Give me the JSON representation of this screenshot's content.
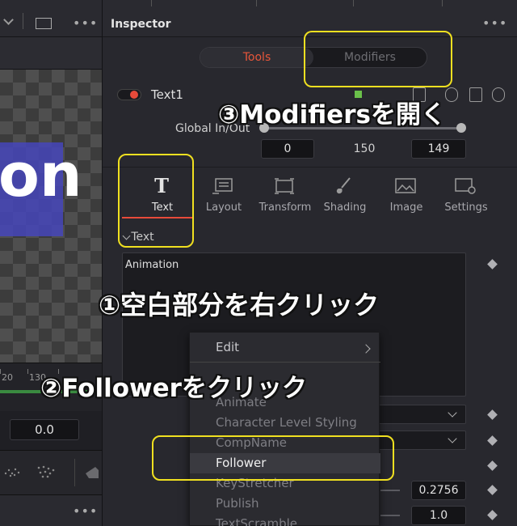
{
  "left": {
    "viewer_text": "on",
    "ruler_labels": [
      "20",
      "130"
    ],
    "time_value": "0.0"
  },
  "inspector": {
    "title": "Inspector",
    "tools_label": "Tools",
    "modifiers_label": "Modifiers",
    "node_name": "Text1",
    "global_inout_label": "Global In/Out",
    "global_in": "0",
    "global_mid": "150",
    "global_out": "149",
    "tabs": [
      {
        "label": "Text",
        "icon": "text-t-icon"
      },
      {
        "label": "Layout",
        "icon": "layout-icon"
      },
      {
        "label": "Transform",
        "icon": "transform-icon"
      },
      {
        "label": "Shading",
        "icon": "brush-icon"
      },
      {
        "label": "Image",
        "icon": "image-icon"
      },
      {
        "label": "Settings",
        "icon": "settings-icon"
      }
    ],
    "section_label": "Text",
    "animation_label": "Animation",
    "value_1": "0.2756",
    "value_2": "1.0"
  },
  "context_menu": {
    "items": [
      {
        "label": "Edit",
        "submenu": true,
        "enabled": true
      },
      {
        "label": "Animate",
        "enabled": false
      },
      {
        "label": "Character Level Styling",
        "enabled": false
      },
      {
        "label": "CompName",
        "enabled": false
      },
      {
        "label": "Follower",
        "enabled": true,
        "highlighted": true
      },
      {
        "label": "KeyStretcher",
        "enabled": false
      },
      {
        "label": "Publish",
        "enabled": false
      },
      {
        "label": "TextScramble",
        "enabled": false
      }
    ]
  },
  "annotations": {
    "step1": "①空白部分を右クリック",
    "step2": "②Followerをクリック",
    "step3": "③Modifiersを開く",
    "highlight_color": "#f0e020"
  },
  "colors": {
    "accent_red": "#e8563a",
    "viewer_blue": "#4646be"
  }
}
